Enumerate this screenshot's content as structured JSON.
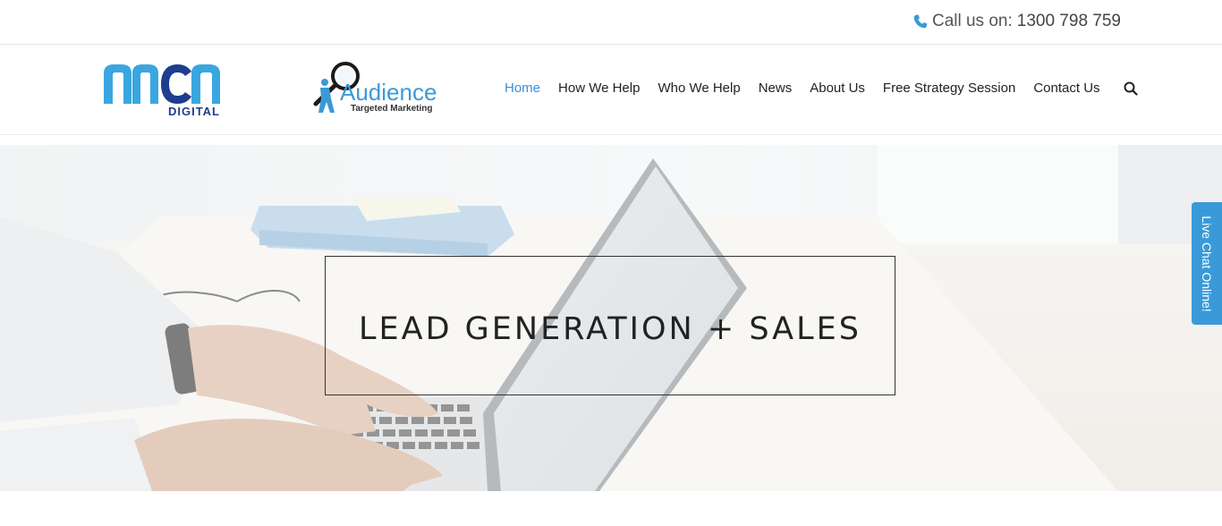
{
  "topbar": {
    "call_label": "Call us on:",
    "phone": "1300 798 759",
    "icon": "phone-icon"
  },
  "logos": {
    "mcm_text": "mcm",
    "mcm_sub": "DIGITAL",
    "audience_text": "Audience",
    "audience_sub": "Targeted Marketing"
  },
  "nav": {
    "items": [
      {
        "label": "Home",
        "active": true
      },
      {
        "label": "How We Help"
      },
      {
        "label": "Who We Help"
      },
      {
        "label": "News"
      },
      {
        "label": "About Us"
      },
      {
        "label": "Free Strategy Session"
      },
      {
        "label": "Contact Us"
      }
    ],
    "search_icon": "search-icon"
  },
  "hero": {
    "title": "LEAD GENERATION + SALES"
  },
  "livechat": {
    "label": "Live Chat Online!"
  },
  "colors": {
    "accent": "#3a8fd6",
    "livechat_bg": "#3a9ad9",
    "mcm_blue": "#3aa6e0",
    "mcm_navy": "#1e3d8f"
  }
}
